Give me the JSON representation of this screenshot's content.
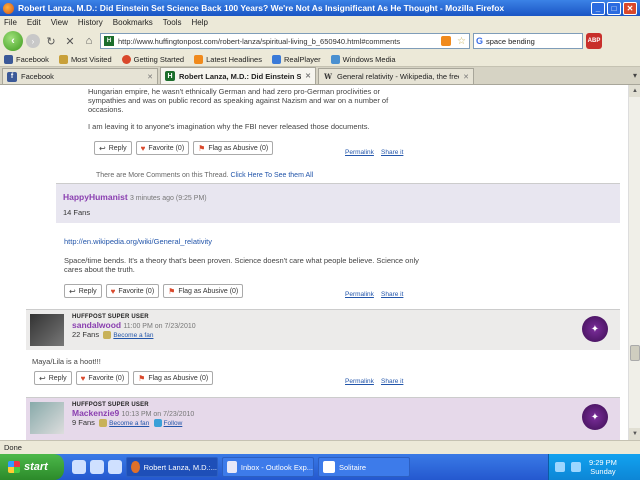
{
  "window": {
    "title": "Robert Lanza, M.D.: Did Einstein Set Science Back 100 Years? We're Not As Insignificant As He Thought - Mozilla Firefox"
  },
  "menu": [
    "File",
    "Edit",
    "View",
    "History",
    "Bookmarks",
    "Tools",
    "Help"
  ],
  "nav": {
    "url": "http://www.huffingtonpost.com/robert-lanza/spiritual-living_b_650940.html#comments",
    "search_value": "space bending"
  },
  "bookmarks": [
    "Facebook",
    "Most Visited",
    "Getting Started",
    "Latest Headlines",
    "RealPlayer",
    "Windows Media"
  ],
  "tabs": [
    {
      "label": "Facebook",
      "icon": "facebook-icon",
      "active": false
    },
    {
      "label": "Robert Lanza, M.D.: Did Einstein S...",
      "icon": "huffpost-icon",
      "active": true
    },
    {
      "label": "General relativity - Wikipedia, the free ...",
      "icon": "wikipedia-icon",
      "active": false
    }
  ],
  "comments": {
    "top_text_1": "Hungarian empire, he wasn't ethnically German and had zero pro-German proclivities or sympathies and was on public record as speaking against Nazism and war on a number of occasions.",
    "top_text_2": "I am leaving it to anyone's imagination why the FBI never released those documents.",
    "reply": "Reply",
    "favorite": "Favorite (0)",
    "flag": "Flag as Abusive (0)",
    "permalink": "Permalink",
    "share": "Share it",
    "more_prefix": "There are More Comments on this Thread.",
    "more_link": "Click Here To See them All",
    "happy": {
      "username": "HappyHumanist",
      "time": "3 minutes ago (9:25 PM)",
      "fans": "14 Fans",
      "link": "http://en.wikipedia.org/wiki/General_relativity",
      "text": "Space/time bends. It's a theory that's been proven. Science doesn't care what people believe. Science only cares about the truth."
    },
    "sandal": {
      "label": "HUFFPOST SUPER USER",
      "username": "sandalwood",
      "time": "11:00 PM on 7/23/2010",
      "fans": "22 Fans",
      "become_fan": "Become a fan",
      "text": "Maya/Lila is a hoot!!!"
    },
    "mack": {
      "label": "HUFFPOST SUPER USER",
      "username": "Mackenzie9",
      "time": "10:13 PM on 7/23/2010",
      "fans": "9 Fans",
      "become_fan": "Become a fan",
      "follow": "Follow"
    }
  },
  "status": {
    "text": "Done"
  },
  "taskbar": {
    "start": "start",
    "items": [
      "Robert Lanza, M.D.:...",
      "Inbox - Outlook Exp...",
      "Solitaire"
    ],
    "time": "9:29 PM",
    "day": "Sunday"
  }
}
